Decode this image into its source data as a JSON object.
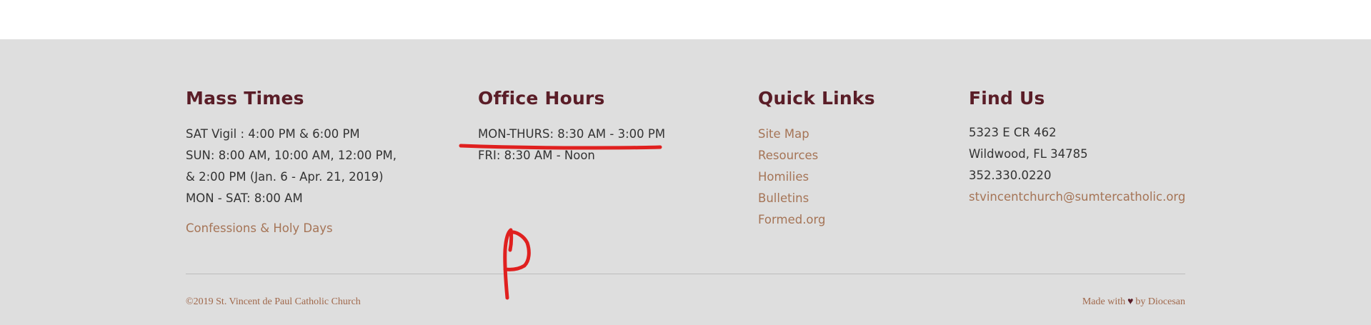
{
  "mass_times": {
    "title": "Mass Times",
    "lines": [
      "SAT Vigil : 4:00 PM & 6:00 PM",
      "SUN: 8:00 AM, 10:00 AM, 12:00 PM,",
      "& 2:00 PM (Jan. 6 - Apr. 21, 2019)",
      "MON - SAT: 8:00 AM"
    ],
    "confessions_link": "Confessions & Holy Days"
  },
  "office_hours": {
    "title": "Office Hours",
    "lines": [
      "MON-THURS: 8:30 AM - 3:00 PM",
      "FRI: 8:30 AM - Noon"
    ]
  },
  "quick_links": {
    "title": "Quick Links",
    "items": [
      "Site Map",
      "Resources",
      "Homilies",
      "Bulletins",
      "Formed.org"
    ]
  },
  "find_us": {
    "title": "Find Us",
    "address1": "5323 E CR 462",
    "address2": "Wildwood, FL 34785",
    "phone": "352.330.0220",
    "email": "stvincentchurch@sumtercatholic.org"
  },
  "bottom": {
    "copyright": "©2019 St. Vincent de Paul Catholic Church",
    "made_with": "Made with",
    "by": "by Diocesan"
  },
  "icons": {
    "heart": "heart-icon"
  },
  "colors": {
    "footer_bg": "#dedede",
    "heading": "#5a1d27",
    "link": "#a57456",
    "annotation": "#e0201f"
  }
}
